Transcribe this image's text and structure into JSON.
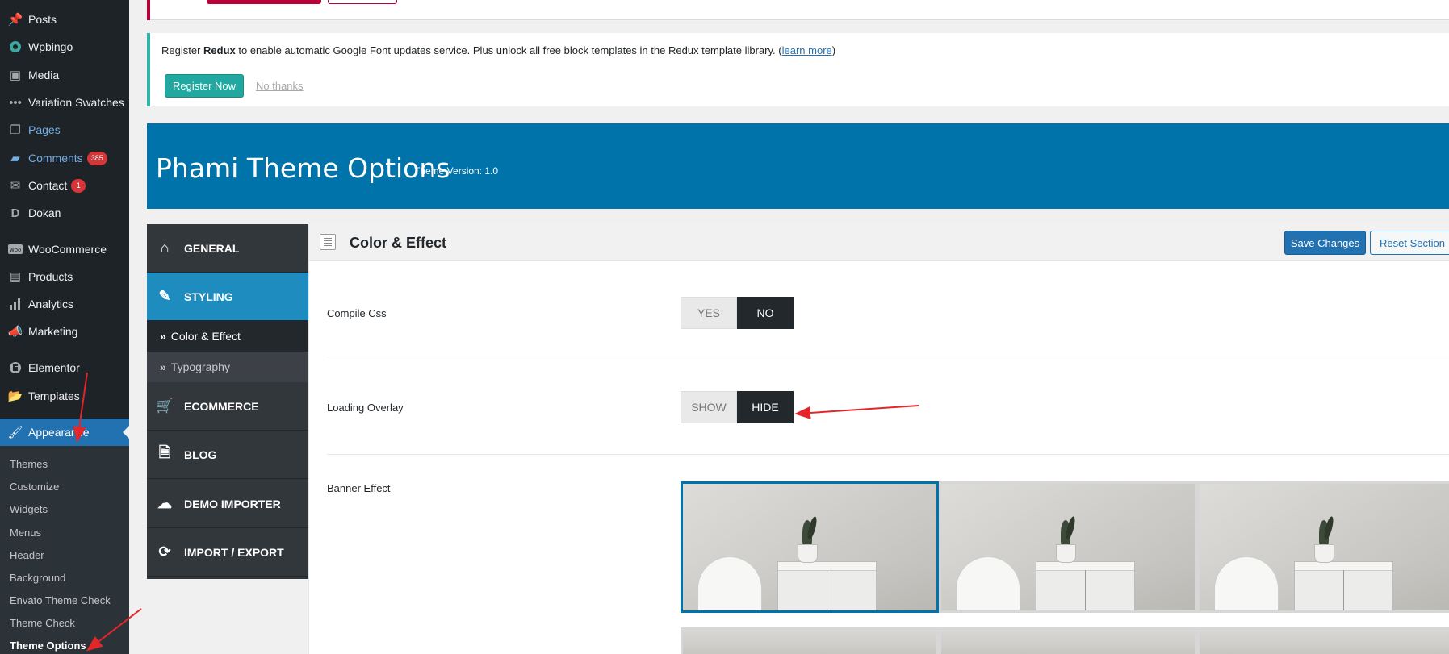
{
  "wp_menu": {
    "items": [
      {
        "label": "Posts",
        "icon": "pin-icon"
      },
      {
        "label": "Wpbingo",
        "icon": "wpbingo-icon"
      },
      {
        "label": "Media",
        "icon": "media-icon"
      },
      {
        "label": "Variation Swatches",
        "icon": "dots-icon"
      },
      {
        "label": "Pages",
        "icon": "pages-icon"
      },
      {
        "label": "Comments",
        "icon": "comment-icon",
        "badge": "385"
      },
      {
        "label": "Contact",
        "icon": "mail-icon",
        "badge": "1"
      },
      {
        "label": "Dokan",
        "icon": "dokan-icon"
      },
      {
        "label": "WooCommerce",
        "icon": "woo-icon"
      },
      {
        "label": "Products",
        "icon": "archive-icon"
      },
      {
        "label": "Analytics",
        "icon": "bar-chart-icon"
      },
      {
        "label": "Marketing",
        "icon": "megaphone-icon"
      },
      {
        "label": "Elementor",
        "icon": "elementor-icon"
      },
      {
        "label": "Templates",
        "icon": "folder-icon"
      },
      {
        "label": "Appearance",
        "icon": "brush-icon"
      }
    ],
    "submenu": [
      "Themes",
      "Customize",
      "Widgets",
      "Menus",
      "Header",
      "Background",
      "Envato Theme Check",
      "Theme Check",
      "Theme Options"
    ]
  },
  "notice": {
    "text_before": "Register ",
    "brand": "Redux",
    "text_after": " to enable automatic Google Font updates service. Plus unlock all free block templates in the Redux template library. (",
    "learn_more": "learn more",
    "text_close": ")",
    "register_button": "Register Now",
    "no_thanks": "No thanks"
  },
  "header": {
    "title": "Phami Theme Options",
    "version": "Theme Version: 1.0"
  },
  "options_menu": {
    "general": "GENERAL",
    "styling": "STYLING",
    "color_effect": "Color & Effect",
    "typography": "Typography",
    "ecommerce": "ECOMMERCE",
    "blog": "BLOG",
    "demo_importer": "DEMO IMPORTER",
    "import_export": "IMPORT / EXPORT",
    "raquo": "»"
  },
  "section": {
    "title": "Color & Effect",
    "save_button": "Save Changes",
    "reset_button": "Reset Section",
    "compile_css": {
      "label": "Compile Css",
      "yes": "YES",
      "no": "NO",
      "selected": "NO"
    },
    "loading_overlay": {
      "label": "Loading Overlay",
      "show": "SHOW",
      "hide": "HIDE",
      "selected": "HIDE"
    },
    "banner_effect": {
      "label": "Banner Effect",
      "selected_index": 0
    }
  },
  "colors": {
    "wp_admin_dark": "#1d2327",
    "wp_blue": "#2271b1",
    "redux_header": "#0073aa",
    "styling_active": "#1e8cbe",
    "register_teal": "#21a8a0",
    "arrow_red": "#e3262a"
  }
}
